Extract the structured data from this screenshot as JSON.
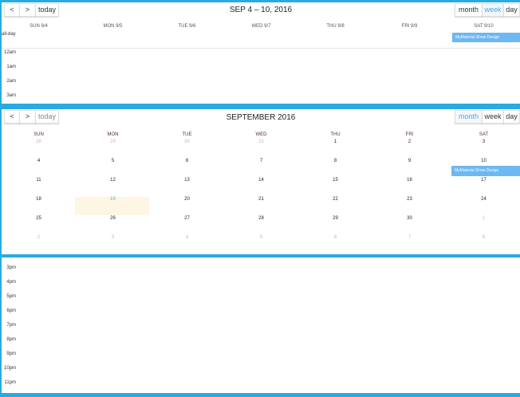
{
  "week_view": {
    "nav": {
      "prev": "<",
      "next": ">",
      "today": "today"
    },
    "title": "SEP 4 – 10, 2016",
    "views": [
      "month",
      "week",
      "day"
    ],
    "active_view": "week",
    "days": [
      "SUN 9/4",
      "MON 9/5",
      "TUE 9/6",
      "WED 9/7",
      "THU 9/8",
      "FRI 9/9",
      "SAT 9/10"
    ],
    "allday_label": "all-day",
    "event": "MyMaterial.Show Design",
    "hours": [
      "12am",
      "1am",
      "2am",
      "3am"
    ]
  },
  "month_view": {
    "nav": {
      "prev": "<",
      "next": ">",
      "today": "today"
    },
    "title": "SEPTEMBER 2016",
    "views": [
      "month",
      "week",
      "day"
    ],
    "active_view": "month",
    "weekdays": [
      "SUN",
      "MON",
      "TUE",
      "WED",
      "THU",
      "FRI",
      "SAT"
    ],
    "weeks": [
      [
        "28",
        "29",
        "30",
        "31",
        "1",
        "2",
        "3"
      ],
      [
        "4",
        "5",
        "6",
        "7",
        "8",
        "9",
        "10"
      ],
      [
        "11",
        "12",
        "13",
        "14",
        "15",
        "16",
        "17"
      ],
      [
        "18",
        "19",
        "20",
        "21",
        "22",
        "23",
        "24"
      ],
      [
        "25",
        "26",
        "27",
        "28",
        "29",
        "30",
        "1"
      ],
      [
        "2",
        "3",
        "4",
        "5",
        "6",
        "7",
        "8"
      ]
    ],
    "today": "19",
    "event": "MyMaterial.Show Design"
  },
  "day_view": {
    "hours": [
      "3pm",
      "4pm",
      "5pm",
      "6pm",
      "7pm",
      "8pm",
      "9pm",
      "10pm",
      "11pm"
    ]
  },
  "colors": {
    "accent": "#29aae1",
    "event": "#6db7f2",
    "today_bg": "#fdf6e3"
  }
}
